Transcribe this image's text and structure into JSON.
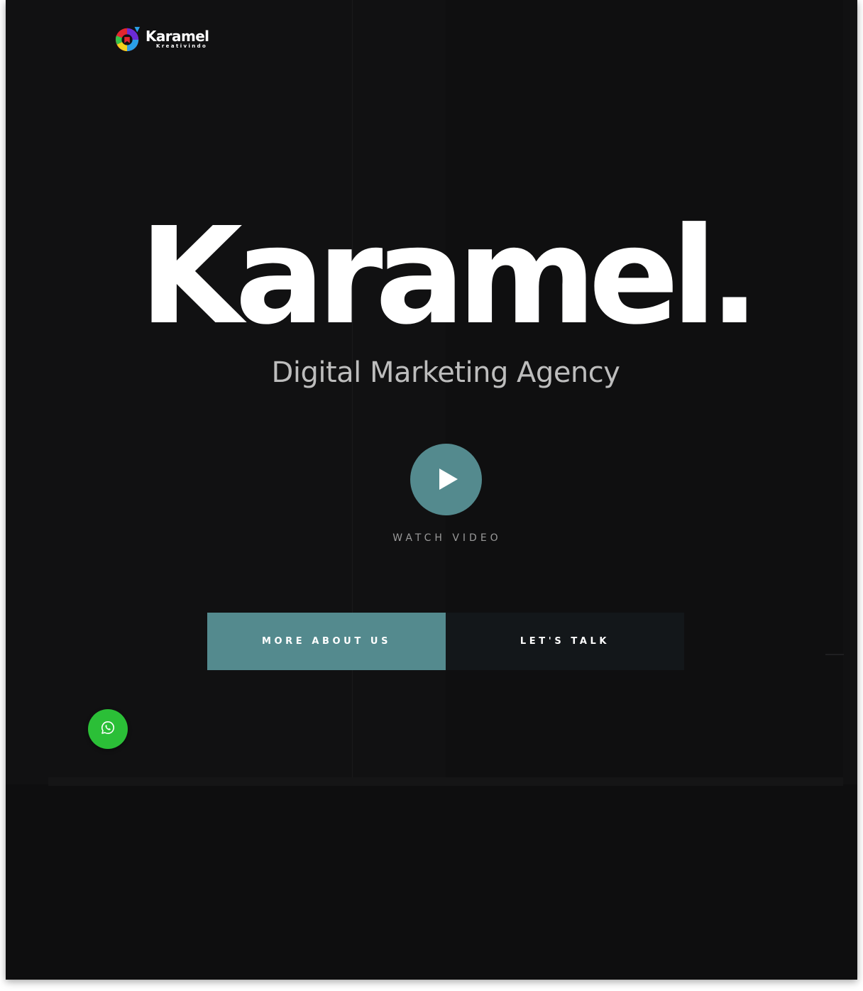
{
  "header": {
    "logo_name": "Karamel",
    "logo_tagline": "Kreativindo"
  },
  "hero": {
    "title": "Karamel.",
    "subtitle": "Digital Marketing Agency",
    "video": {
      "label": "WATCH VIDEO",
      "icon": "play-icon"
    },
    "buttons": {
      "primary_label": "MORE ABOUT US",
      "secondary_label": "LET'S TALK"
    }
  },
  "floating": {
    "whatsapp_icon": "whatsapp-icon"
  },
  "colors": {
    "accent": "#548a8e",
    "background": "#111112",
    "whatsapp": "#2bbf37"
  }
}
